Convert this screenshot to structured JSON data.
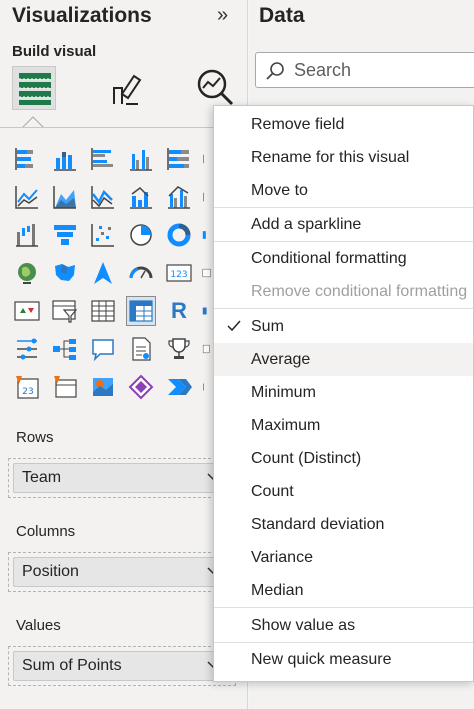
{
  "viz_pane": {
    "title": "Visualizations",
    "collapse_icon": "»",
    "build_visual_label": "Build visual",
    "top_icons": [
      "build-visual-icon",
      "format-visual-icon",
      "analytics-icon"
    ],
    "r_visual_letter": "R",
    "wells": [
      {
        "label": "Rows",
        "field": "Team"
      },
      {
        "label": "Columns",
        "field": "Position"
      },
      {
        "label": "Values",
        "field": "Sum of Points"
      }
    ]
  },
  "data_pane": {
    "title": "Data",
    "search_placeholder": "Search"
  },
  "context_menu": {
    "items": [
      {
        "label": "Remove field"
      },
      {
        "label": "Rename for this visual"
      },
      {
        "label": "Move to"
      },
      {
        "label": "Add a sparkline"
      },
      {
        "label": "Conditional formatting"
      },
      {
        "label": "Remove conditional formatting",
        "disabled": true
      },
      {
        "label": "Sum",
        "checked": true
      },
      {
        "label": "Average",
        "hover": true
      },
      {
        "label": "Minimum"
      },
      {
        "label": "Maximum"
      },
      {
        "label": "Count (Distinct)"
      },
      {
        "label": "Count"
      },
      {
        "label": "Standard deviation"
      },
      {
        "label": "Variance"
      },
      {
        "label": "Median"
      },
      {
        "label": "Show value as"
      },
      {
        "label": "New quick measure"
      }
    ]
  },
  "colors": {
    "accent_blue": "#2b78c5",
    "teal": "#118dff",
    "green": "#2e7d32",
    "orange": "#e8711a",
    "purple": "#8b3fb8"
  }
}
